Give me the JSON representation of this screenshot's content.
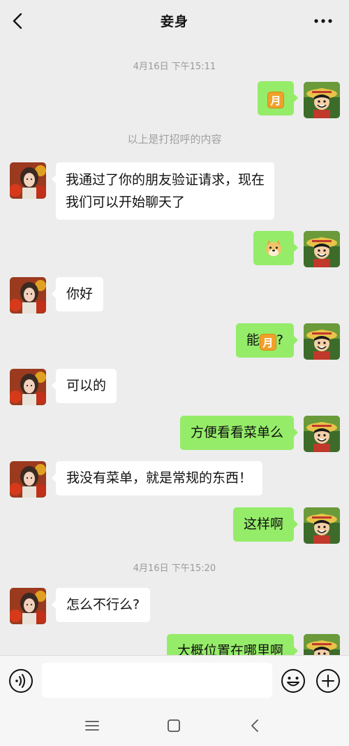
{
  "header": {
    "title": "妾身",
    "back_icon": "chevron-left-icon",
    "more_icon": "more-dots-icon"
  },
  "chat": {
    "timestamp_1": "4月16日 下午15:11",
    "msg_1_moon_emoji": "月",
    "system_note": "以上是打招呼的内容",
    "msg_2_line_1": "我通过了你的朋友验证请求，现在",
    "msg_2_line_2": "我们可以开始聊天了",
    "msg_3_emoji": "doge-emoji",
    "msg_4": "你好",
    "msg_5_prefix": "能",
    "msg_5_emoji": "月",
    "msg_5_suffix": "?",
    "msg_6": "可以的",
    "msg_7": "方便看看菜单么",
    "msg_8": "我没有菜单，就是常规的东西！",
    "msg_9": "这样啊",
    "timestamp_2": "4月16日 下午15:20",
    "msg_10": "怎么不行么?",
    "msg_11": "大概位置在哪里啊"
  },
  "input_bar": {
    "voice_icon": "voice-icon",
    "text_value": "",
    "emoji_icon": "smiley-icon",
    "plus_icon": "plus-circle-icon"
  },
  "system_nav": {
    "menu_icon": "menu-icon",
    "home_icon": "home-square-icon",
    "back_icon": "back-triangle-icon"
  },
  "colors": {
    "background": "#ededed",
    "outgoing_bubble": "#95ec69",
    "incoming_bubble": "#ffffff",
    "timestamp_text": "#9a9a9a"
  }
}
